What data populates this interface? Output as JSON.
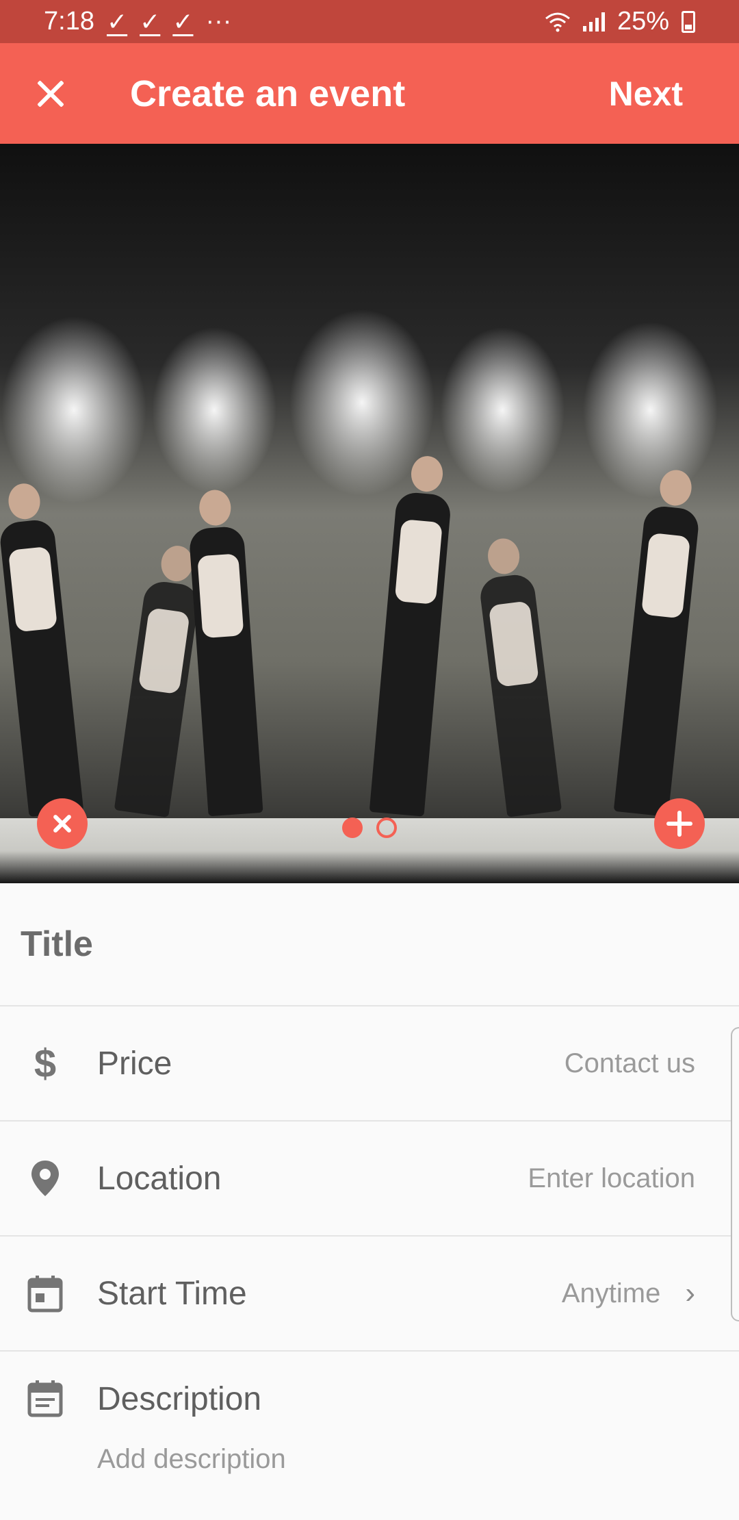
{
  "status_bar": {
    "time": "7:18",
    "notifications": [
      "✓",
      "✓",
      "✓"
    ],
    "more": "···",
    "battery": "25%"
  },
  "app_bar": {
    "title": "Create an event",
    "next_label": "Next",
    "background": "#f46154"
  },
  "carousel": {
    "total": 2,
    "active_index": 0
  },
  "form": {
    "title_placeholder": "Title",
    "rows": [
      {
        "icon": "dollar-icon",
        "label": "Price",
        "value": "Contact us"
      },
      {
        "icon": "location-pin-icon",
        "label": "Location",
        "value": "Enter location"
      },
      {
        "icon": "calendar-icon",
        "label": "Start Time",
        "value": "Anytime"
      }
    ],
    "description": {
      "icon": "calendar-note-icon",
      "label": "Description",
      "placeholder": "Add description"
    }
  },
  "colors": {
    "accent": "#f46154",
    "status_bar": "#c0463c"
  }
}
